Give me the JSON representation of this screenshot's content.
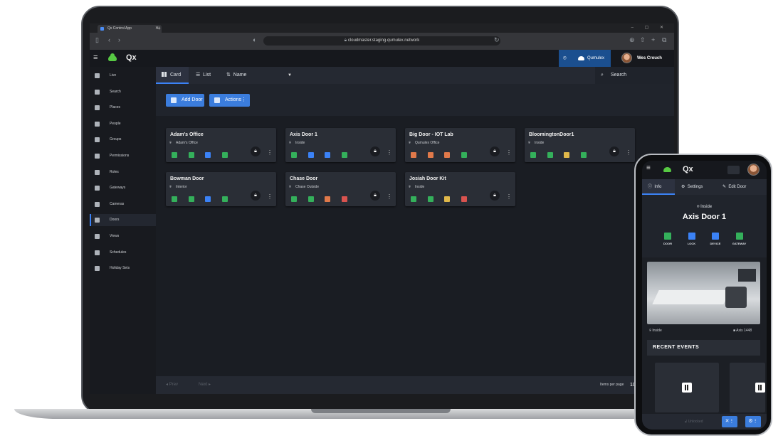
{
  "browser": {
    "tab_title": "Qx Control App",
    "url": "cloudmaster.staging.qumulex.network"
  },
  "app": {
    "logo_text": "Qx",
    "place_name": "Qumulex",
    "user_name": "Wes Crouch"
  },
  "sidebar": {
    "items": [
      {
        "label": "Live",
        "icon": "monitor-icon"
      },
      {
        "label": "Search",
        "icon": "search-icon"
      },
      {
        "label": "Places",
        "icon": "pin-icon"
      },
      {
        "label": "People",
        "icon": "person-icon"
      },
      {
        "label": "Groups",
        "icon": "group-icon"
      },
      {
        "label": "Permissions",
        "icon": "key-icon"
      },
      {
        "label": "Roles",
        "icon": "roles-icon"
      },
      {
        "label": "Gateways",
        "icon": "gateway-icon"
      },
      {
        "label": "Cameras",
        "icon": "camera-icon"
      },
      {
        "label": "Doors",
        "icon": "door-icon",
        "active": true
      },
      {
        "label": "Views",
        "icon": "eye-icon"
      },
      {
        "label": "Schedules",
        "icon": "calendar-icon"
      },
      {
        "label": "Holiday Sets",
        "icon": "hourglass-icon"
      }
    ]
  },
  "toolbar": {
    "card_label": "Card",
    "list_label": "List",
    "sort_label": "Name",
    "search_placeholder": "Search"
  },
  "actions": {
    "add_door_label": "Add Door",
    "actions_label": "Actions"
  },
  "status_colors": {
    "green": "#34b05b",
    "blue": "#3b82f6",
    "orange": "#e0794a",
    "yellow": "#e0b84a",
    "red": "#d9534f"
  },
  "doors": [
    {
      "name": "Adam's Office",
      "place": "Adam's Office",
      "statuses": [
        "green",
        "green",
        "blue",
        "green"
      ]
    },
    {
      "name": "Axis Door 1",
      "place": "Inside",
      "statuses": [
        "green",
        "blue",
        "blue",
        "green"
      ]
    },
    {
      "name": "Big Door - IOT Lab",
      "place": "Qumulex Office",
      "statuses": [
        "orange",
        "orange",
        "orange",
        "green"
      ]
    },
    {
      "name": "BloomingtonDoor1",
      "place": "Inside",
      "statuses": [
        "green",
        "green",
        "yellow",
        "green"
      ]
    },
    {
      "name": "Bowman Door",
      "place": "Interior",
      "statuses": [
        "green",
        "green",
        "blue",
        "green"
      ]
    },
    {
      "name": "Chase Door",
      "place": "Chase Outside",
      "statuses": [
        "green",
        "green",
        "orange",
        "red"
      ]
    },
    {
      "name": "Josiah Door Kit",
      "place": "Inside",
      "statuses": [
        "green",
        "green",
        "yellow",
        "red"
      ]
    }
  ],
  "pager": {
    "prev_label": "Prev",
    "next_label": "Next",
    "items_per_page_label": "Items per page",
    "items_per_page": "10"
  },
  "phone": {
    "logo_text": "Qx",
    "tabs": [
      "Info",
      "Settings",
      "Edit Door"
    ],
    "door_place": "Inside",
    "door_name": "Axis Door 1",
    "statuses": [
      {
        "label": "DOOR",
        "color": "#34b05b"
      },
      {
        "label": "LOCK",
        "color": "#3b82f6"
      },
      {
        "label": "DEVICE",
        "color": "#3b82f6"
      },
      {
        "label": "GATEWAY",
        "color": "#34b05b"
      }
    ],
    "camera_place": "Inside",
    "camera_name": "Axis 1448",
    "recent_events_label": "RECENT EVENTS",
    "unlock_label": "Unlocked"
  }
}
